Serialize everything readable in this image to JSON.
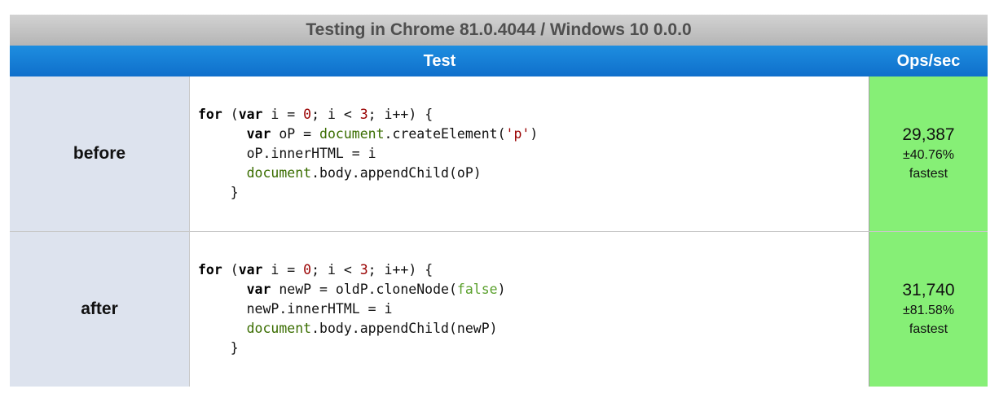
{
  "caption": "Testing in Chrome 81.0.4044 / Windows 10 0.0.0",
  "headers": {
    "test": "Test",
    "ops": "Ops/sec"
  },
  "colors": {
    "caption_bg": "#c4c4c4",
    "header_bg": "#1581d6",
    "title_cell_bg": "#dde3ee",
    "fastest_bg": "#86ef76"
  },
  "tests": [
    {
      "title": "before",
      "code": {
        "for_kw": "for",
        "for_open": " (",
        "var_kw": "var",
        "for_cond_a": " i = ",
        "zero": "0",
        "for_cond_b": "; i < ",
        "three": "3",
        "for_cond_c": "; i++) {",
        "l2_var": "var",
        "l2_a": " oP = ",
        "l2_obj": "document",
        "l2_b": ".createElement(",
        "l2_str": "'p'",
        "l2_c": ")",
        "l3": "oP.innerHTML = i",
        "l4_obj": "document",
        "l4_rest": ".body.appendChild(oP)",
        "close": "}"
      },
      "ops": "29,387",
      "error": "±40.76%",
      "rank": "fastest"
    },
    {
      "title": "after",
      "code": {
        "for_kw": "for",
        "for_open": " (",
        "var_kw": "var",
        "for_cond_a": " i = ",
        "zero": "0",
        "for_cond_b": "; i < ",
        "three": "3",
        "for_cond_c": "; i++) {",
        "l2_var": "var",
        "l2_a": " newP = oldP.cloneNode(",
        "l2_lit": "false",
        "l2_c": ")",
        "l3": "newP.innerHTML = i",
        "l4_obj": "document",
        "l4_rest": ".body.appendChild(newP)",
        "close": "}"
      },
      "ops": "31,740",
      "error": "±81.58%",
      "rank": "fastest"
    }
  ]
}
